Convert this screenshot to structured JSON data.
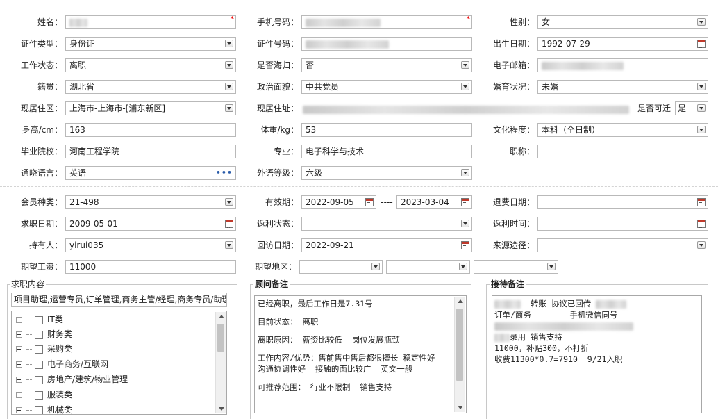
{
  "basic": {
    "name_label": "姓名：",
    "phone_label": "手机号码：",
    "gender_label": "性别：",
    "gender_value": "女",
    "id_type_label": "证件类型：",
    "id_type_value": "身份证",
    "id_no_label": "证件号码：",
    "birth_label": "出生日期：",
    "birth_value": "1992-07-29",
    "work_status_label": "工作状态：",
    "work_status_value": "离职",
    "returnee_label": "是否海归：",
    "returnee_value": "否",
    "email_label": "电子邮箱：",
    "native_label": "籍贯：",
    "native_value": "湖北省",
    "political_label": "政治面貌：",
    "political_value": "中共党员",
    "marital_label": "婚育状况：",
    "marital_value": "未婚",
    "residence_area_label": "现居住区：",
    "residence_area_value": "上海市-上海市-[浦东新区]",
    "address_label": "现居住址：",
    "relocate_label": "是否可迁",
    "relocate_value": "是",
    "height_label": "身高/cm：",
    "height_value": "163",
    "weight_label": "体重/kg：",
    "weight_value": "53",
    "education_label": "文化程度：",
    "education_value": "本科（全日制）",
    "school_label": "毕业院校：",
    "school_value": "河南工程学院",
    "major_label": "专业：",
    "major_value": "电子科学与技术",
    "title_label": "职称：",
    "title_value": "",
    "language_label": "通晓语言：",
    "language_value": "英语",
    "language_more": "•••",
    "lang_level_label": "外语等级：",
    "lang_level_value": "六级"
  },
  "member": {
    "type_label": "会员种类：",
    "type_value": "21-498",
    "valid_label": "有效期：",
    "valid_from": "2022-09-05",
    "valid_sep": "----",
    "valid_to": "2023-03-04",
    "refund_label": "退费日期：",
    "refund_value": "",
    "job_date_label": "求职日期：",
    "job_date_value": "2009-05-01",
    "rebate_status_label": "返利状态：",
    "rebate_status_value": "",
    "rebate_time_label": "返利时间：",
    "rebate_time_value": "",
    "holder_label": "持有人：",
    "holder_value": "yirui035",
    "visit_label": "回访日期：",
    "visit_value": "2022-09-21",
    "source_label": "来源途径：",
    "source_value": "",
    "salary_label": "期望工资：",
    "salary_value": "11000",
    "area_label": "期望地区："
  },
  "job_content": {
    "title": "求职内容",
    "summary": "项目助理,运营专员,订单管理,商务主管/经理,商务专员/助理",
    "tree": [
      {
        "label": "IT类"
      },
      {
        "label": "财务类"
      },
      {
        "label": "采购类"
      },
      {
        "label": "电子商务/互联网"
      },
      {
        "label": "房地产/建筑/物业管理"
      },
      {
        "label": "服装类"
      },
      {
        "label": "机械类"
      }
    ]
  },
  "advisor": {
    "title": "顾问备注",
    "lines": [
      "已经离职，最后工作日是7.31号",
      "",
      "目前状态： 离职",
      "",
      "离职原因： 薪资比较低  岗位发展瓶颈",
      "",
      "工作内容/优势：售前售中售后都很擅长 稳定性好",
      "沟通协调性好  接触的面比较广  英文一般",
      "",
      "可推荐范围： 行业不限制  销售支持"
    ]
  },
  "reception": {
    "title": "接待备注",
    "line1_text": "转账 协议已回传",
    "line2_a": "订单/商务",
    "line2_b": "手机微信同号",
    "line4_text": "录用 销售支持",
    "line5": "11000，补贴300，不打折",
    "line6": "收费11300*0.7=7910  9/21入职"
  },
  "colors": {
    "required": "#e00000",
    "link": "#2a5caa",
    "border": "#b9b9b9"
  }
}
